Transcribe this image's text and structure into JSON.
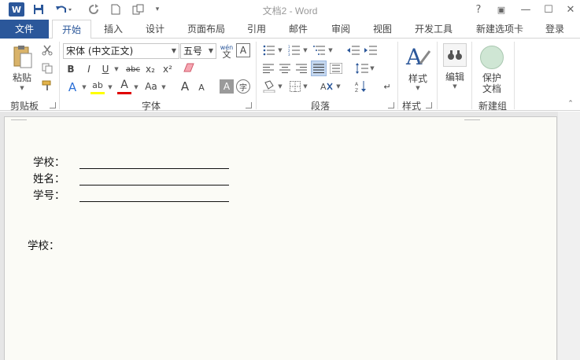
{
  "titlebar": {
    "app_icon": "W",
    "title": "文档2 - Word",
    "help": "?",
    "ribbon_display": "▣",
    "minimize": "—",
    "restore": "☐",
    "close": "✕"
  },
  "tabs": {
    "file": "文件",
    "home": "开始",
    "insert": "插入",
    "design": "设计",
    "layout": "页面布局",
    "references": "引用",
    "mailings": "邮件",
    "review": "审阅",
    "view": "视图",
    "developer": "开发工具",
    "new_tab": "新建选项卡",
    "login": "登录"
  },
  "ribbon": {
    "clipboard": {
      "paste": "粘贴",
      "label": "剪贴板"
    },
    "font": {
      "font_name": "宋体 (中文正文)",
      "font_size": "五号",
      "pinyin": "wén",
      "bold": "B",
      "italic": "I",
      "underline": "U",
      "strikethrough": "abc",
      "subscript": "x₂",
      "superscript": "x²",
      "change_case": "Aa",
      "grow": "A",
      "shrink": "A",
      "char_shading": "A",
      "enclose": "字",
      "label": "字体"
    },
    "paragraph": {
      "label": "段落"
    },
    "styles": {
      "button": "样式",
      "label": "样式"
    },
    "editing": {
      "button": "编辑"
    },
    "protect": {
      "line1": "保护",
      "line2": "文档",
      "label": "新建组"
    }
  },
  "document": {
    "school_label": "学校：",
    "name_label": "姓名：",
    "id_label": "学号：",
    "school_label_2": "学校："
  },
  "colors": {
    "accent": "#2b579a",
    "highlight_yellow": "#ffff00",
    "font_red": "#e00000",
    "page_bg": "#fbfbf6"
  }
}
